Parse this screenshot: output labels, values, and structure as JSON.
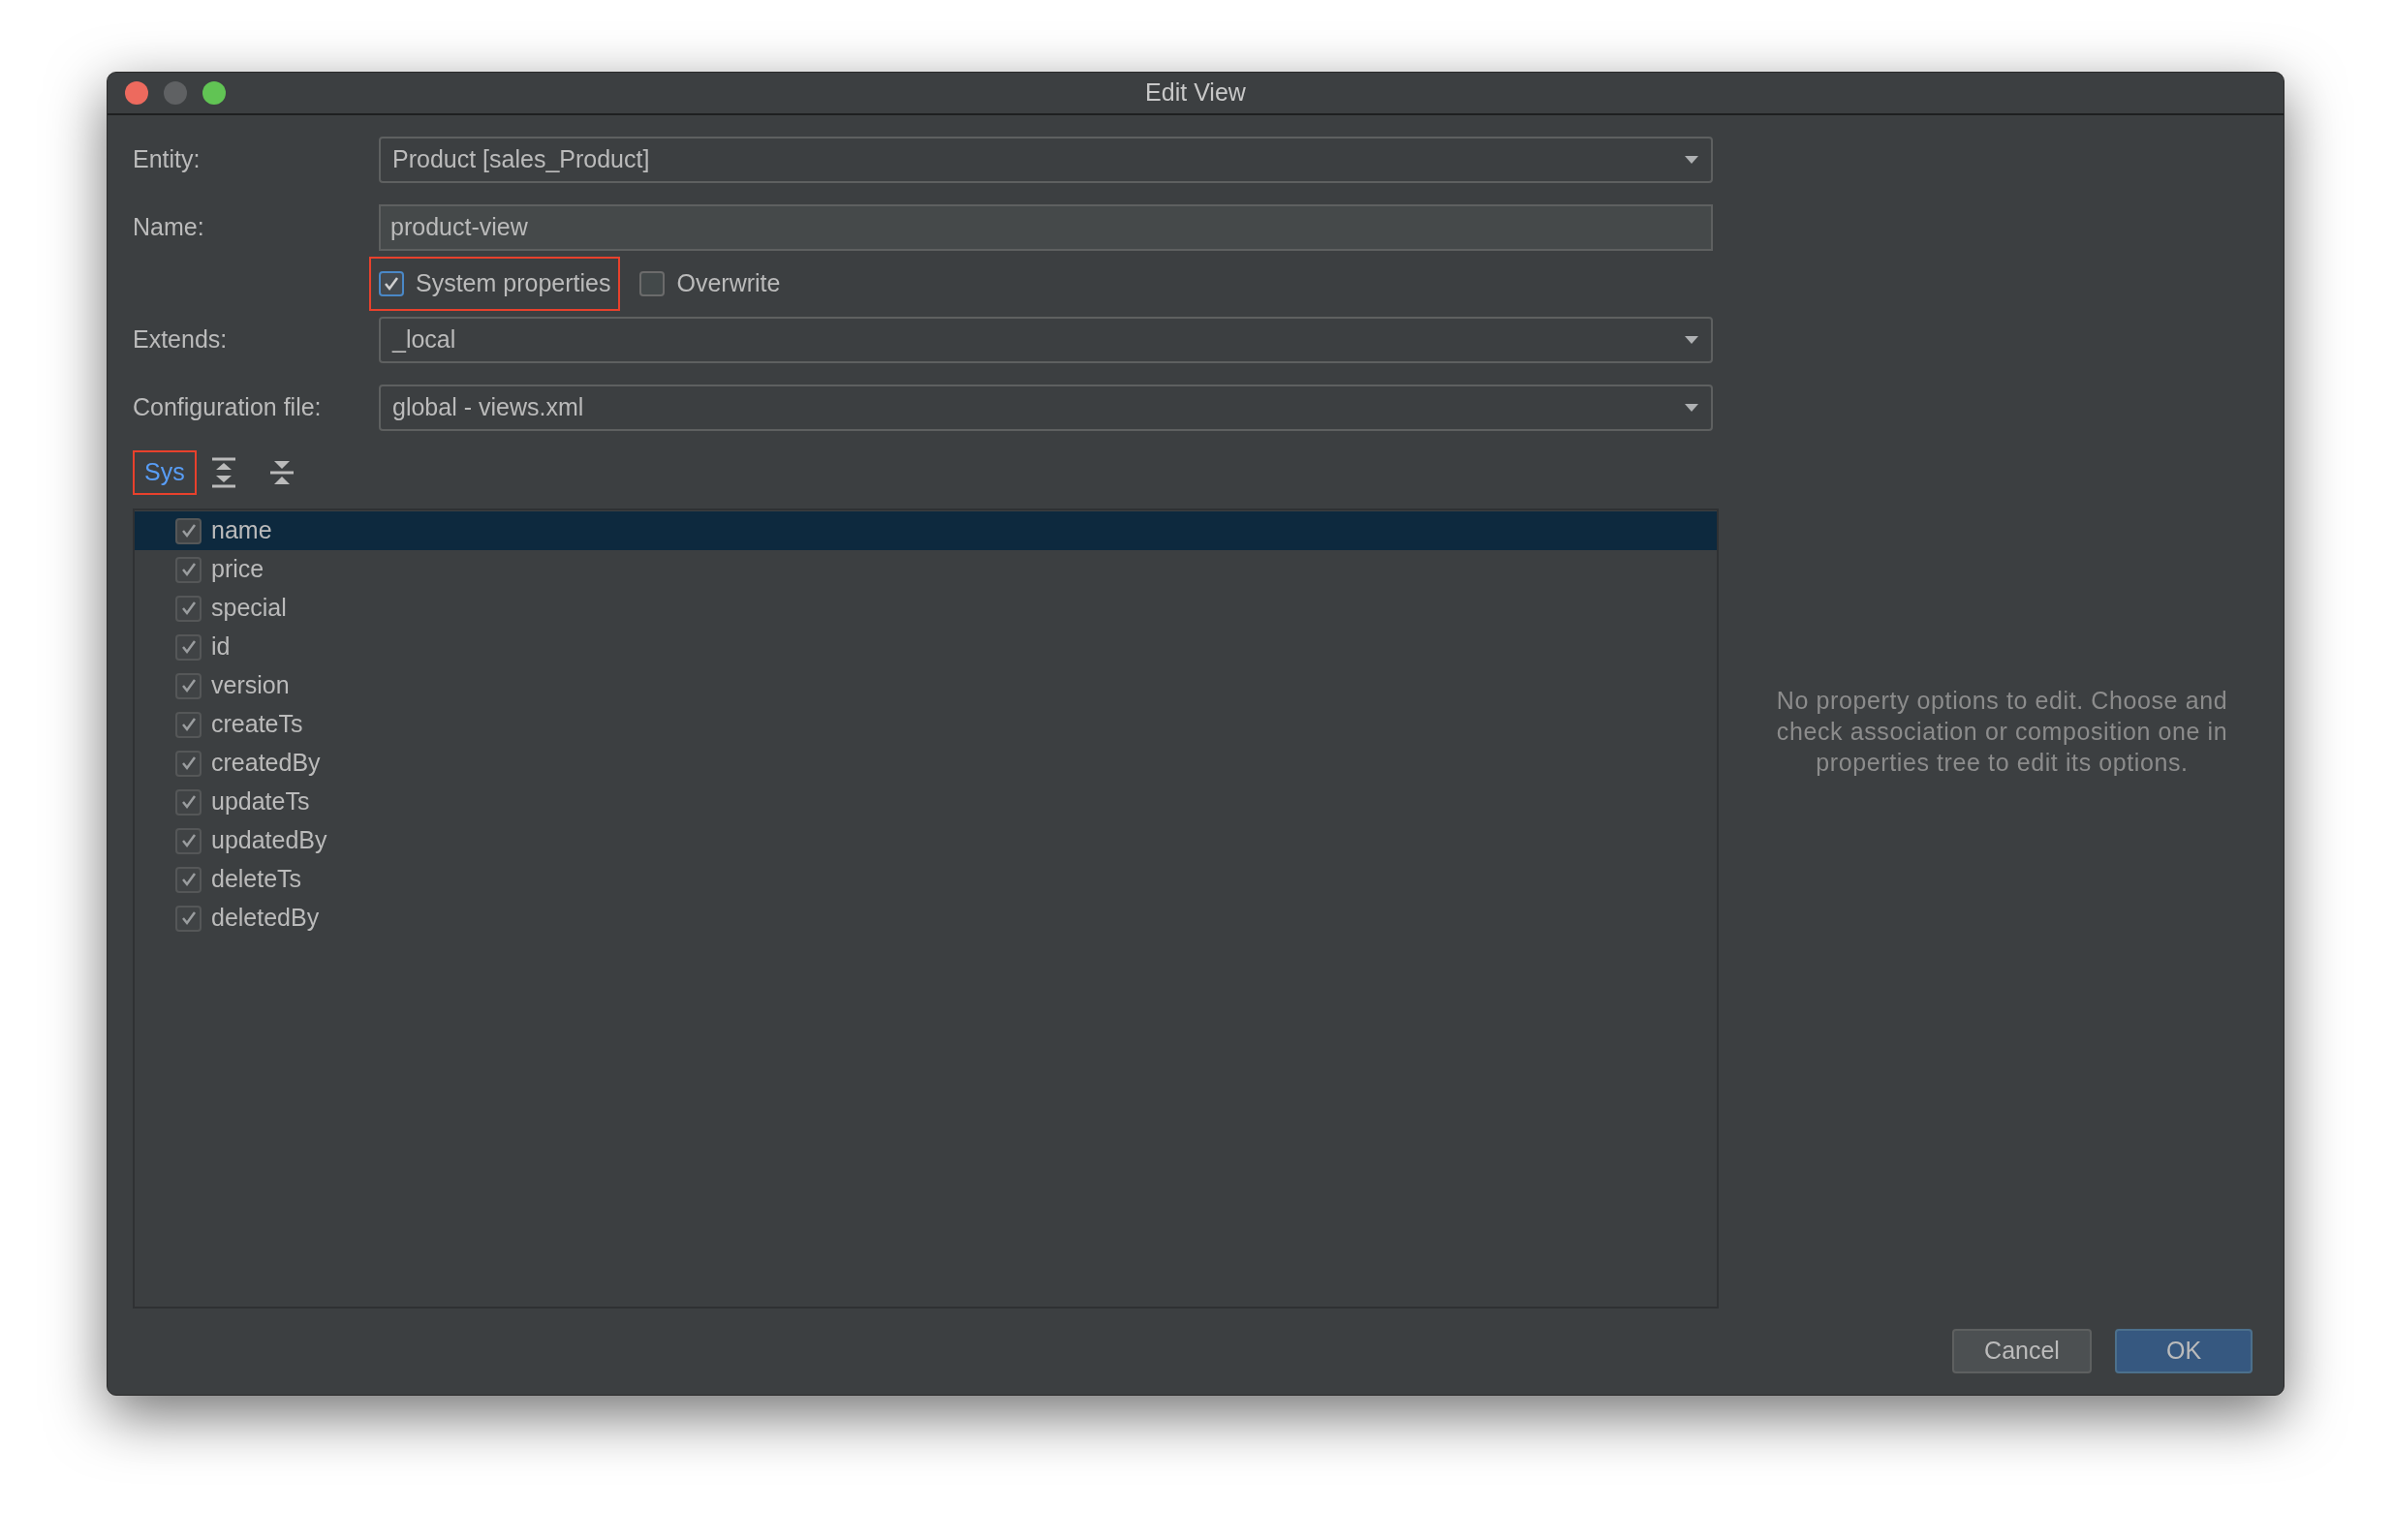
{
  "window": {
    "title": "Edit View"
  },
  "form": {
    "entity": {
      "label": "Entity:",
      "value": "Product [sales_Product]"
    },
    "name": {
      "label": "Name:",
      "value": "product-view"
    },
    "options": [
      {
        "label": "System properties",
        "checked": true,
        "highlighted": true
      },
      {
        "label": "Overwrite",
        "checked": false,
        "highlighted": false
      }
    ],
    "extends": {
      "label": "Extends:",
      "value": "_local"
    },
    "configuration_file": {
      "label": "Configuration file:",
      "value": "global - views.xml"
    }
  },
  "toolbar": {
    "sys_button": {
      "label": "Sys",
      "highlighted": true
    }
  },
  "tree": {
    "items": [
      {
        "label": "name",
        "checked": true,
        "selected": true
      },
      {
        "label": "price",
        "checked": true,
        "selected": false
      },
      {
        "label": "special",
        "checked": true,
        "selected": false
      },
      {
        "label": "id",
        "checked": true,
        "selected": false
      },
      {
        "label": "version",
        "checked": true,
        "selected": false
      },
      {
        "label": "createTs",
        "checked": true,
        "selected": false
      },
      {
        "label": "createdBy",
        "checked": true,
        "selected": false
      },
      {
        "label": "updateTs",
        "checked": true,
        "selected": false
      },
      {
        "label": "updatedBy",
        "checked": true,
        "selected": false
      },
      {
        "label": "deleteTs",
        "checked": true,
        "selected": false
      },
      {
        "label": "deletedBy",
        "checked": true,
        "selected": false
      }
    ]
  },
  "hint": "No property options to edit. Choose and check association or composition one in properties tree to edit its options.",
  "buttons": [
    {
      "label": "Cancel",
      "kind": "secondary"
    },
    {
      "label": "OK",
      "kind": "primary"
    }
  ]
}
